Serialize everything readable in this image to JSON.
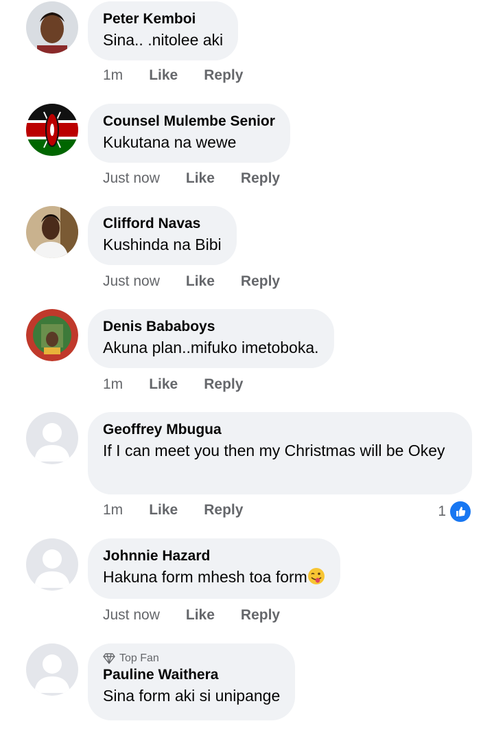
{
  "comments": [
    {
      "name": "Peter Kemboi",
      "text": "Sina.. .nitolee aki",
      "time": "1m",
      "like": "Like",
      "reply": "Reply"
    },
    {
      "name": "Counsel Mulembe Senior",
      "text": "Kukutana na wewe",
      "time": "Just now",
      "like": "Like",
      "reply": "Reply"
    },
    {
      "name": "Clifford Navas",
      "text": "Kushinda na Bibi",
      "time": "Just now",
      "like": "Like",
      "reply": "Reply"
    },
    {
      "name": "Denis Bababoys",
      "text": "Akuna plan..mifuko imetoboka.",
      "time": "1m",
      "like": "Like",
      "reply": "Reply"
    },
    {
      "name": "Geoffrey Mbugua",
      "text": "If I can meet you then my Christmas will be Okey",
      "time": "1m",
      "like": "Like",
      "reply": "Reply",
      "reaction_count": "1"
    },
    {
      "name": "Johnnie Hazard",
      "text": "Hakuna form mhesh toa form",
      "time": "Just now",
      "like": "Like",
      "reply": "Reply"
    },
    {
      "badge": "Top Fan",
      "name": "Pauline Waithera",
      "text": "Sina form aki si unipange"
    }
  ],
  "colors": {
    "bubble": "#f0f2f5",
    "meta": "#65676b",
    "like_blue": "#1877f2"
  }
}
